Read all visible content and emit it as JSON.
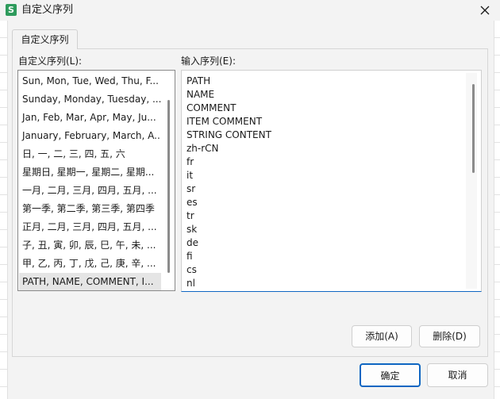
{
  "window": {
    "title": "自定义序列",
    "app_icon_letter": "S",
    "colors": {
      "app_icon": "#2e9b5c",
      "focus_accent": "#0f66c2",
      "selected_item_bg": "#e5e5e5"
    }
  },
  "tab": {
    "label": "自定义序列"
  },
  "left": {
    "label": "自定义序列(L):",
    "items": [
      "Sun, Mon, Tue, Wed, Thu, F...",
      "Sunday, Monday, Tuesday, ...",
      "Jan, Feb, Mar, Apr, May, Ju...",
      "January, February, March, A...",
      "日, 一, 二, 三, 四, 五, 六",
      "星期日, 星期一, 星期二, 星期...",
      "一月, 二月, 三月, 四月, 五月, ...",
      "第一季, 第二季, 第三季, 第四季",
      "正月, 二月, 三月, 四月, 五月, ...",
      "子, 丑, 寅, 卯, 辰, 巳, 午, 未, ...",
      "甲, 乙, 丙, 丁, 戊, 己, 庚, 辛, ...",
      "PATH, NAME, COMMENT, I..."
    ],
    "selected_index": 11
  },
  "right": {
    "label": "输入序列(E):",
    "lines": [
      "PATH",
      "NAME",
      "COMMENT",
      "ITEM COMMENT",
      "STRING CONTENT",
      "zh-rCN",
      "fr",
      "it",
      "sr",
      "es",
      "tr",
      "sk",
      "de",
      "fi",
      "cs",
      "nl"
    ]
  },
  "buttons": {
    "add": "添加(A)",
    "delete": "删除(D)",
    "ok": "确定",
    "cancel": "取消"
  },
  "icons": {
    "close": "close-icon",
    "app": "app-icon"
  }
}
